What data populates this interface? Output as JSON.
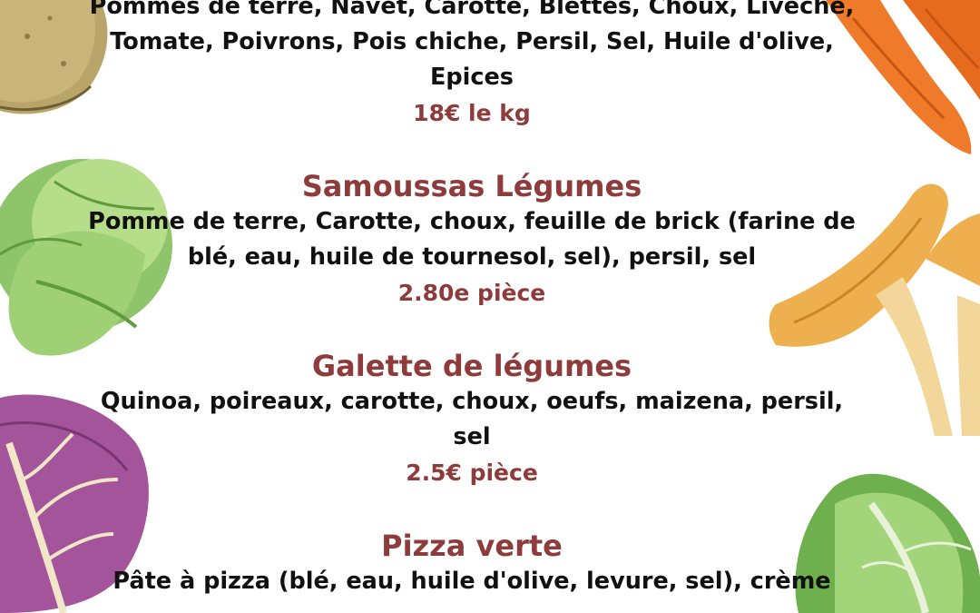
{
  "sections": [
    {
      "title": "",
      "ingredients": "Pommes de terre, Navet, Carotte, Blettes, Choux, Livèche, Tomate, Poivrons, Pois chiche, Persil, Sel, Huile d'olive, Epices",
      "price": "18€ le kg"
    },
    {
      "title": "Samoussas Légumes",
      "ingredients": "Pomme de terre, Carotte, choux, feuille de brick (farine de blé, eau, huile de tournesol, sel), persil, sel",
      "price": "2.80e pièce"
    },
    {
      "title": "Galette de légumes",
      "ingredients": "Quinoa, poireaux, carotte, choux, oeufs, maizena, persil, sel",
      "price": "2.5€ pièce"
    },
    {
      "title": "Pizza verte",
      "ingredients": "Pâte à pizza (blé, eau, huile d'olive, levure, sel), crème",
      "price": ""
    }
  ],
  "colors": {
    "accent": "#8e3b3b",
    "text": "#111111",
    "background": "#ffffff"
  },
  "decorations": [
    "potato-illustration",
    "carrot-illustration",
    "cabbage-illustration",
    "chanterelle-mushroom-illustration",
    "red-cabbage-leaf-illustration",
    "chard-leaf-illustration"
  ]
}
